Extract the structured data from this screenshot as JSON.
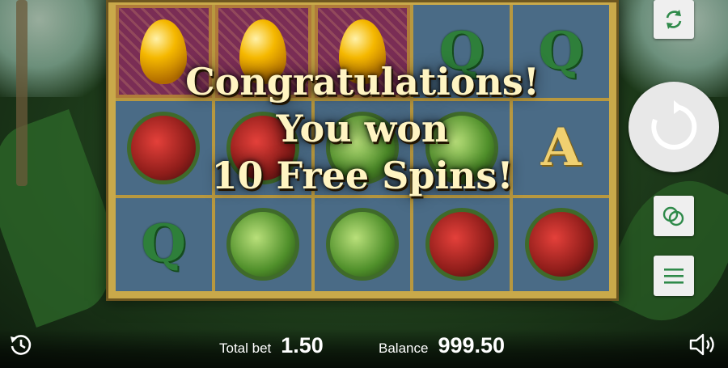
{
  "message": {
    "line1": "Congratulations!",
    "line2": "You won",
    "line3": "10 Free Spins!"
  },
  "bottom": {
    "total_bet_label": "Total bet",
    "total_bet_value": "1.50",
    "balance_label": "Balance",
    "balance_value": "999.50"
  },
  "reels": [
    [
      "golden-egg",
      "golden-egg",
      "golden-egg",
      "q",
      "q"
    ],
    [
      "red-parrot",
      "red-parrot",
      "green-parrot",
      "green-parrot",
      "a"
    ],
    [
      "q",
      "green-parrot",
      "green-parrot",
      "red-parrot",
      "red-parrot"
    ]
  ],
  "icons": {
    "autoplay": "autoplay-icon",
    "spin": "spin-icon",
    "bet": "coins-icon",
    "menu": "menu-icon",
    "history": "history-icon",
    "sound": "sound-icon"
  },
  "colors": {
    "frame": "#c9a94a",
    "reel_bg": "#4a6b86",
    "message_text": "#fff4c2",
    "button_bg": "#efefef",
    "icon_green": "#2f8a4a"
  }
}
